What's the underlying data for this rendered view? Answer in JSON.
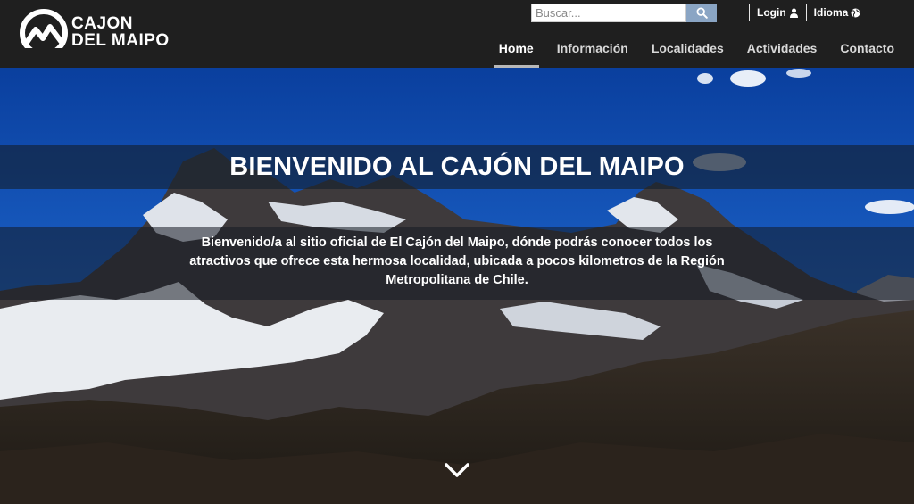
{
  "brand": {
    "line1": "CAJON",
    "line2": "DEL MAIPO"
  },
  "search": {
    "placeholder": "Buscar...",
    "icon": "search-icon"
  },
  "top_links": {
    "login": "Login",
    "language": "Idioma"
  },
  "nav": {
    "items": [
      "Home",
      "Información",
      "Localidades",
      "Actividades",
      "Contacto"
    ],
    "active": "Home"
  },
  "hero": {
    "title": "BIENVENIDO AL CAJÓN DEL MAIPO",
    "description": "Bienvenido/a al sitio oficial de El Cajón del Maipo, dónde podrás conocer todos los atractivos que ofrece esta hermosa localidad, ubicada a pocos kilometros de la Región Metropolitana de Chile.",
    "scroll_icon": "chevron-down-icon"
  },
  "colors": {
    "header_bg": "#1f1f1f",
    "sky": "#0d47a8",
    "search_button": "#8aa5c4"
  }
}
